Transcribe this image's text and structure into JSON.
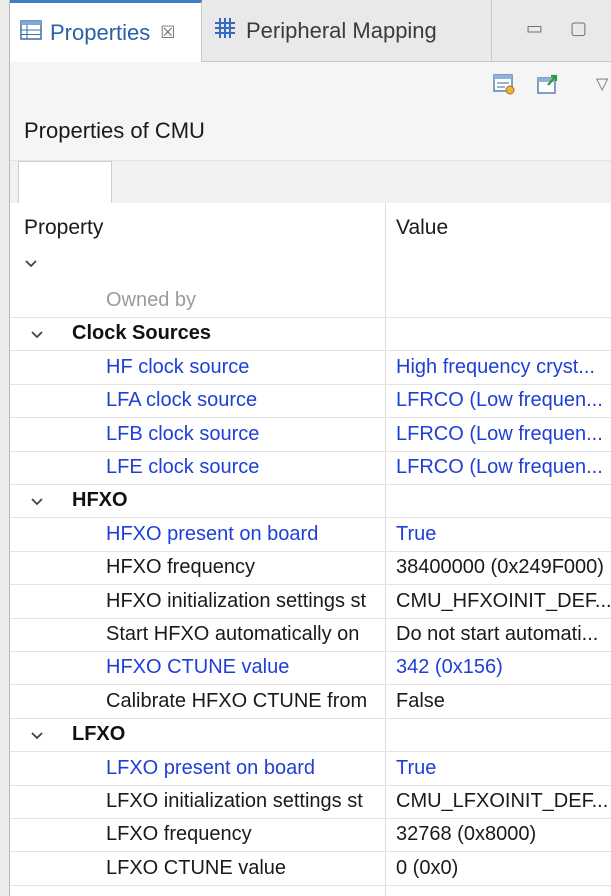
{
  "tabs": {
    "properties_label": "Properties",
    "close_glyph": "☒",
    "peripheral_label": "Peripheral Mapping"
  },
  "window_controls": {
    "minimize": "▭",
    "maximize": "▢",
    "menu": "▽"
  },
  "toolbar": {
    "icons": [
      "properties-view-icon",
      "export-icon"
    ]
  },
  "header": {
    "title": "Properties of CMU"
  },
  "table": {
    "col_property": "Property",
    "col_value": "Value",
    "rows": [
      {
        "kind": "item",
        "label": "Owned by",
        "value": "",
        "style": "grey"
      },
      {
        "kind": "category",
        "label": "Clock Sources",
        "value": ""
      },
      {
        "kind": "item",
        "label": "HF clock source",
        "value": "High frequency cryst...",
        "style": "blue"
      },
      {
        "kind": "item",
        "label": "LFA clock source",
        "value": "LFRCO (Low frequen...",
        "style": "blue"
      },
      {
        "kind": "item",
        "label": "LFB clock source",
        "value": "LFRCO (Low frequen...",
        "style": "blue"
      },
      {
        "kind": "item",
        "label": "LFE clock source",
        "value": "LFRCO (Low frequen...",
        "style": "blue"
      },
      {
        "kind": "category",
        "label": "HFXO",
        "value": ""
      },
      {
        "kind": "item",
        "label": "HFXO present on board",
        "value": "True",
        "style": "blue"
      },
      {
        "kind": "item",
        "label": "HFXO frequency",
        "value": "38400000 (0x249F000)",
        "style": "normal"
      },
      {
        "kind": "item",
        "label": "HFXO initialization settings st",
        "value": "CMU_HFXOINIT_DEF...",
        "style": "normal"
      },
      {
        "kind": "item",
        "label": "Start HFXO automatically on",
        "value": "Do not start automati...",
        "style": "normal"
      },
      {
        "kind": "item",
        "label": "HFXO CTUNE value",
        "value": "342 (0x156)",
        "style": "blue"
      },
      {
        "kind": "item",
        "label": "Calibrate HFXO CTUNE from",
        "value": "False",
        "style": "normal"
      },
      {
        "kind": "category",
        "label": "LFXO",
        "value": ""
      },
      {
        "kind": "item",
        "label": "LFXO present on board",
        "value": "True",
        "style": "blue"
      },
      {
        "kind": "item",
        "label": "LFXO initialization settings st",
        "value": "CMU_LFXOINIT_DEF...",
        "style": "normal"
      },
      {
        "kind": "item",
        "label": "LFXO frequency",
        "value": "32768 (0x8000)",
        "style": "normal"
      },
      {
        "kind": "item",
        "label": "LFXO CTUNE value",
        "value": "0 (0x0)",
        "style": "normal"
      }
    ]
  }
}
